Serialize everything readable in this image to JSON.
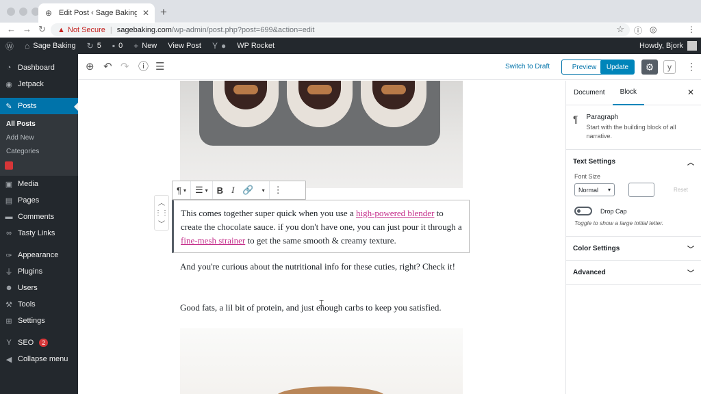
{
  "browser": {
    "tab_title": "Edit Post ‹ Sage Baking — Wo",
    "not_secure": "Not Secure",
    "url_host": "sagebaking.com",
    "url_path": "/wp-admin/post.php?post=699&action=edit"
  },
  "adminbar": {
    "site_name": "Sage Baking",
    "updates_count": "5",
    "comments_count": "0",
    "new_label": "New",
    "view_post_label": "View Post",
    "wp_rocket_label": "WP Rocket",
    "howdy": "Howdy, Bjork"
  },
  "sidebar": {
    "dashboard": "Dashboard",
    "jetpack": "Jetpack",
    "posts": "Posts",
    "submenu": [
      "All Posts",
      "Add New",
      "Categories"
    ],
    "media": "Media",
    "pages": "Pages",
    "comments": "Comments",
    "tasty_links": "Tasty Links",
    "appearance": "Appearance",
    "plugins": "Plugins",
    "users": "Users",
    "tools": "Tools",
    "settings": "Settings",
    "seo": "SEO",
    "seo_badge": "2",
    "collapse": "Collapse menu"
  },
  "toolbar": {
    "switch_to_draft": "Switch to Draft",
    "preview": "Preview",
    "update": "Update"
  },
  "content": {
    "para1_a": "This comes together super quick when you use a ",
    "para1_link1": "high-powered blender",
    "para1_b": " to create the chocolate sauce. if you don't have one, you can just pour it through a ",
    "para1_link2": "fine-mesh strainer",
    "para1_c": " to get the same smooth & creamy texture.",
    "para2": "And you're curious about the nutritional info for these cuties, right? Check it!",
    "para3": "Good fats, a lil bit of protein, and just enough carbs to keep you satisfied."
  },
  "panel": {
    "tab_document": "Document",
    "tab_block": "Block",
    "block_name": "Paragraph",
    "block_desc": "Start with the building block of all narrative.",
    "text_settings": "Text Settings",
    "font_size_label": "Font Size",
    "font_size_value": "Normal",
    "reset": "Reset",
    "drop_cap": "Drop Cap",
    "drop_cap_help": "Toggle to show a large initial letter.",
    "color_settings": "Color Settings",
    "advanced": "Advanced"
  }
}
